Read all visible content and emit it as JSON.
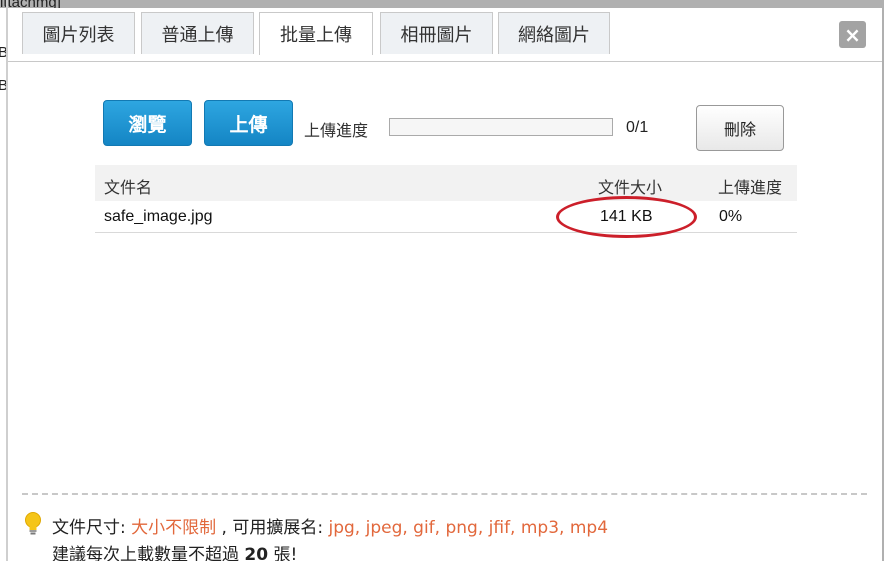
{
  "background": {
    "snippet_top": "ittachmg]",
    "snippet_b1": "B",
    "snippet_b2": "B"
  },
  "tabs": [
    {
      "label": "圖片列表",
      "active": false
    },
    {
      "label": "普通上傳",
      "active": false
    },
    {
      "label": "批量上傳",
      "active": true
    },
    {
      "label": "相冊圖片",
      "active": false
    },
    {
      "label": "網絡圖片",
      "active": false
    }
  ],
  "close_label": "×",
  "toolbar": {
    "browse_label": "瀏覽",
    "upload_label": "上傳",
    "progress_label": "上傳進度",
    "progress_count": "0/1",
    "progress_fraction": 0,
    "delete_label": "刪除"
  },
  "table": {
    "headers": [
      "文件名",
      "文件大小",
      "上傳進度"
    ],
    "rows": [
      {
        "name": "safe_image.jpg",
        "size": "141 KB",
        "progress": "0%"
      }
    ]
  },
  "footer": {
    "size_label": "文件尺寸: ",
    "size_value": "大小不限制",
    "ext_label": " , 可用擴展名: ",
    "ext_value": "jpg, jpeg, gif, png, jfif, mp3, mp4",
    "advice_prefix": "建議每次上載數量不超過 ",
    "advice_count": "20",
    "advice_suffix": " 張!"
  },
  "colors": {
    "accent": "#e2683c",
    "button_blue": "#1d95d4",
    "highlight_red": "#cc1f2a"
  },
  "icons": {
    "tip": "lightbulb-icon",
    "close": "close-icon"
  }
}
